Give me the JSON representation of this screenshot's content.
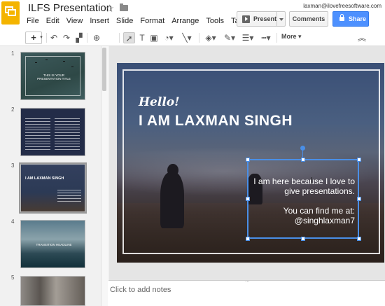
{
  "app": {
    "title": "ILFS Presentation",
    "email": "laxman@ilovefreesoftware.com",
    "menu": [
      "File",
      "Edit",
      "View",
      "Insert",
      "Slide",
      "Format",
      "Arrange",
      "Tools",
      "Table"
    ],
    "present_label": "Present",
    "comments_label": "Comments",
    "share_label": "Share",
    "more_label": "More"
  },
  "colors": {
    "share_blue": "#4d90fe",
    "selection_blue": "#4a8fe7",
    "logo_yellow": "#f4b400"
  },
  "icons": [
    "add-icon",
    "undo-icon",
    "redo-icon",
    "paint-format-icon",
    "zoom-icon",
    "select-cursor-icon",
    "text-box-icon",
    "image-icon",
    "shape-icon",
    "line-icon",
    "fill-color-icon",
    "line-color-icon",
    "line-weight-icon",
    "line-dash-icon",
    "collapse-icon"
  ],
  "filmstrip": {
    "slide_numbers": [
      "1",
      "2",
      "3",
      "4",
      "5"
    ],
    "slide1_title": "THIS IS YOUR PRESENTATION TITLE",
    "slide3_title": "I AM LAXMAN SINGH",
    "slide4_title": "TRANSITION HEADLINE"
  },
  "slide": {
    "greeting": "Hello!",
    "headline": "I AM LAXMAN SINGH",
    "body_line1": "I am here because I love to give presentations.",
    "body_line2": "You can find me at: @singhlaxman7"
  },
  "notes": {
    "placeholder": "Click to add notes"
  }
}
